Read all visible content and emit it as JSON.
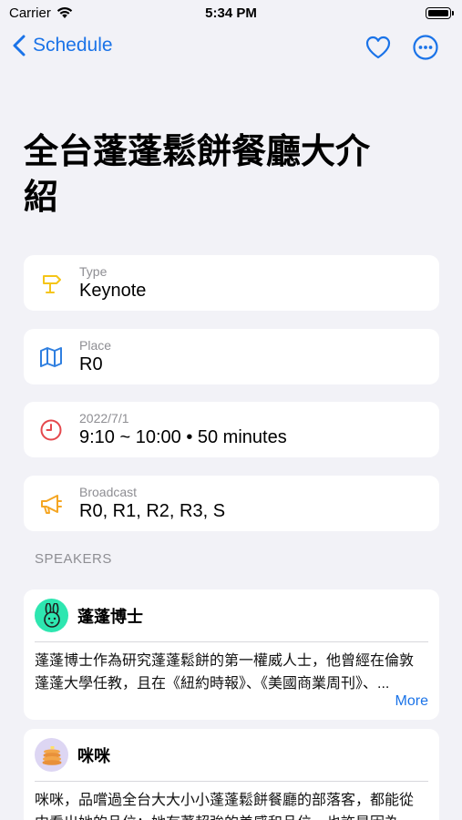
{
  "status_bar": {
    "carrier": "Carrier",
    "time": "5:34 PM"
  },
  "nav": {
    "back_label": "Schedule"
  },
  "page_title": "全台蓬蓬鬆餅餐廳大介紹",
  "info": [
    {
      "label": "Type",
      "value": "Keynote",
      "icon": "signpost-icon",
      "color": "#f5c518"
    },
    {
      "label": "Place",
      "value": "R0",
      "icon": "map-icon",
      "color": "#2f7fe0"
    },
    {
      "label": "2022/7/1",
      "value": "9:10 ~ 10:00 • 50 minutes",
      "icon": "clock-icon",
      "color": "#e5484d"
    },
    {
      "label": "Broadcast",
      "value": "R0, R1, R2, R3, S",
      "icon": "megaphone-icon",
      "color": "#f5a623"
    }
  ],
  "speakers_header": "SPEAKERS",
  "speakers": [
    {
      "name": "蓬蓬博士",
      "avatar": "bunny-avatar",
      "avatar_color": "#2ee6b0",
      "bio_line1": "蓬蓬博士作為研究蓬蓬鬆餅的第一權威人士，他曾經在倫敦",
      "bio_line2": "蓬蓬大學任教，且在《紐約時報》、《美國商業周刊》、...",
      "more_label": "More"
    },
    {
      "name": "咪咪",
      "avatar": "pancake-avatar",
      "avatar_color": "#ddd6f3",
      "bio_line1": "咪咪，品嚐過全台大大小小蓬蓬鬆餅餐廳的部落客，都能從",
      "bio_line2": "中看出她的品位：她有著超強的美感和品位，也許是因為"
    }
  ]
}
